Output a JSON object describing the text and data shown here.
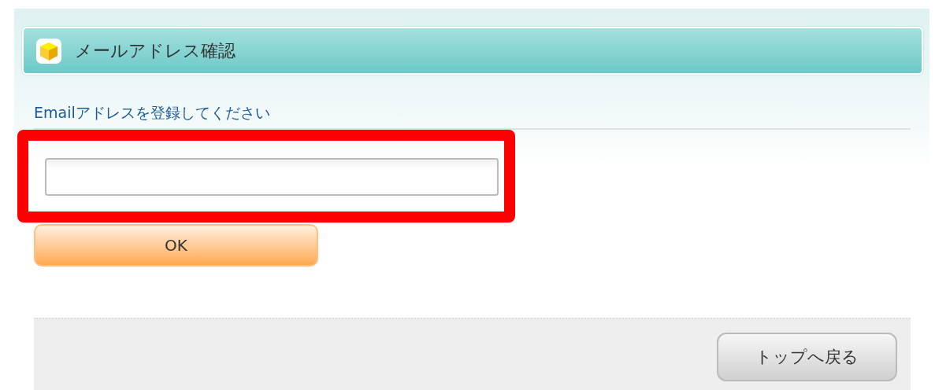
{
  "header": {
    "title": "メールアドレス確認"
  },
  "form": {
    "label": "Emailアドレスを登録してください",
    "email_field": {
      "highlighted": true
    },
    "submit_button": "OK"
  },
  "footer": {
    "back_button": "トップへ戻る"
  }
}
